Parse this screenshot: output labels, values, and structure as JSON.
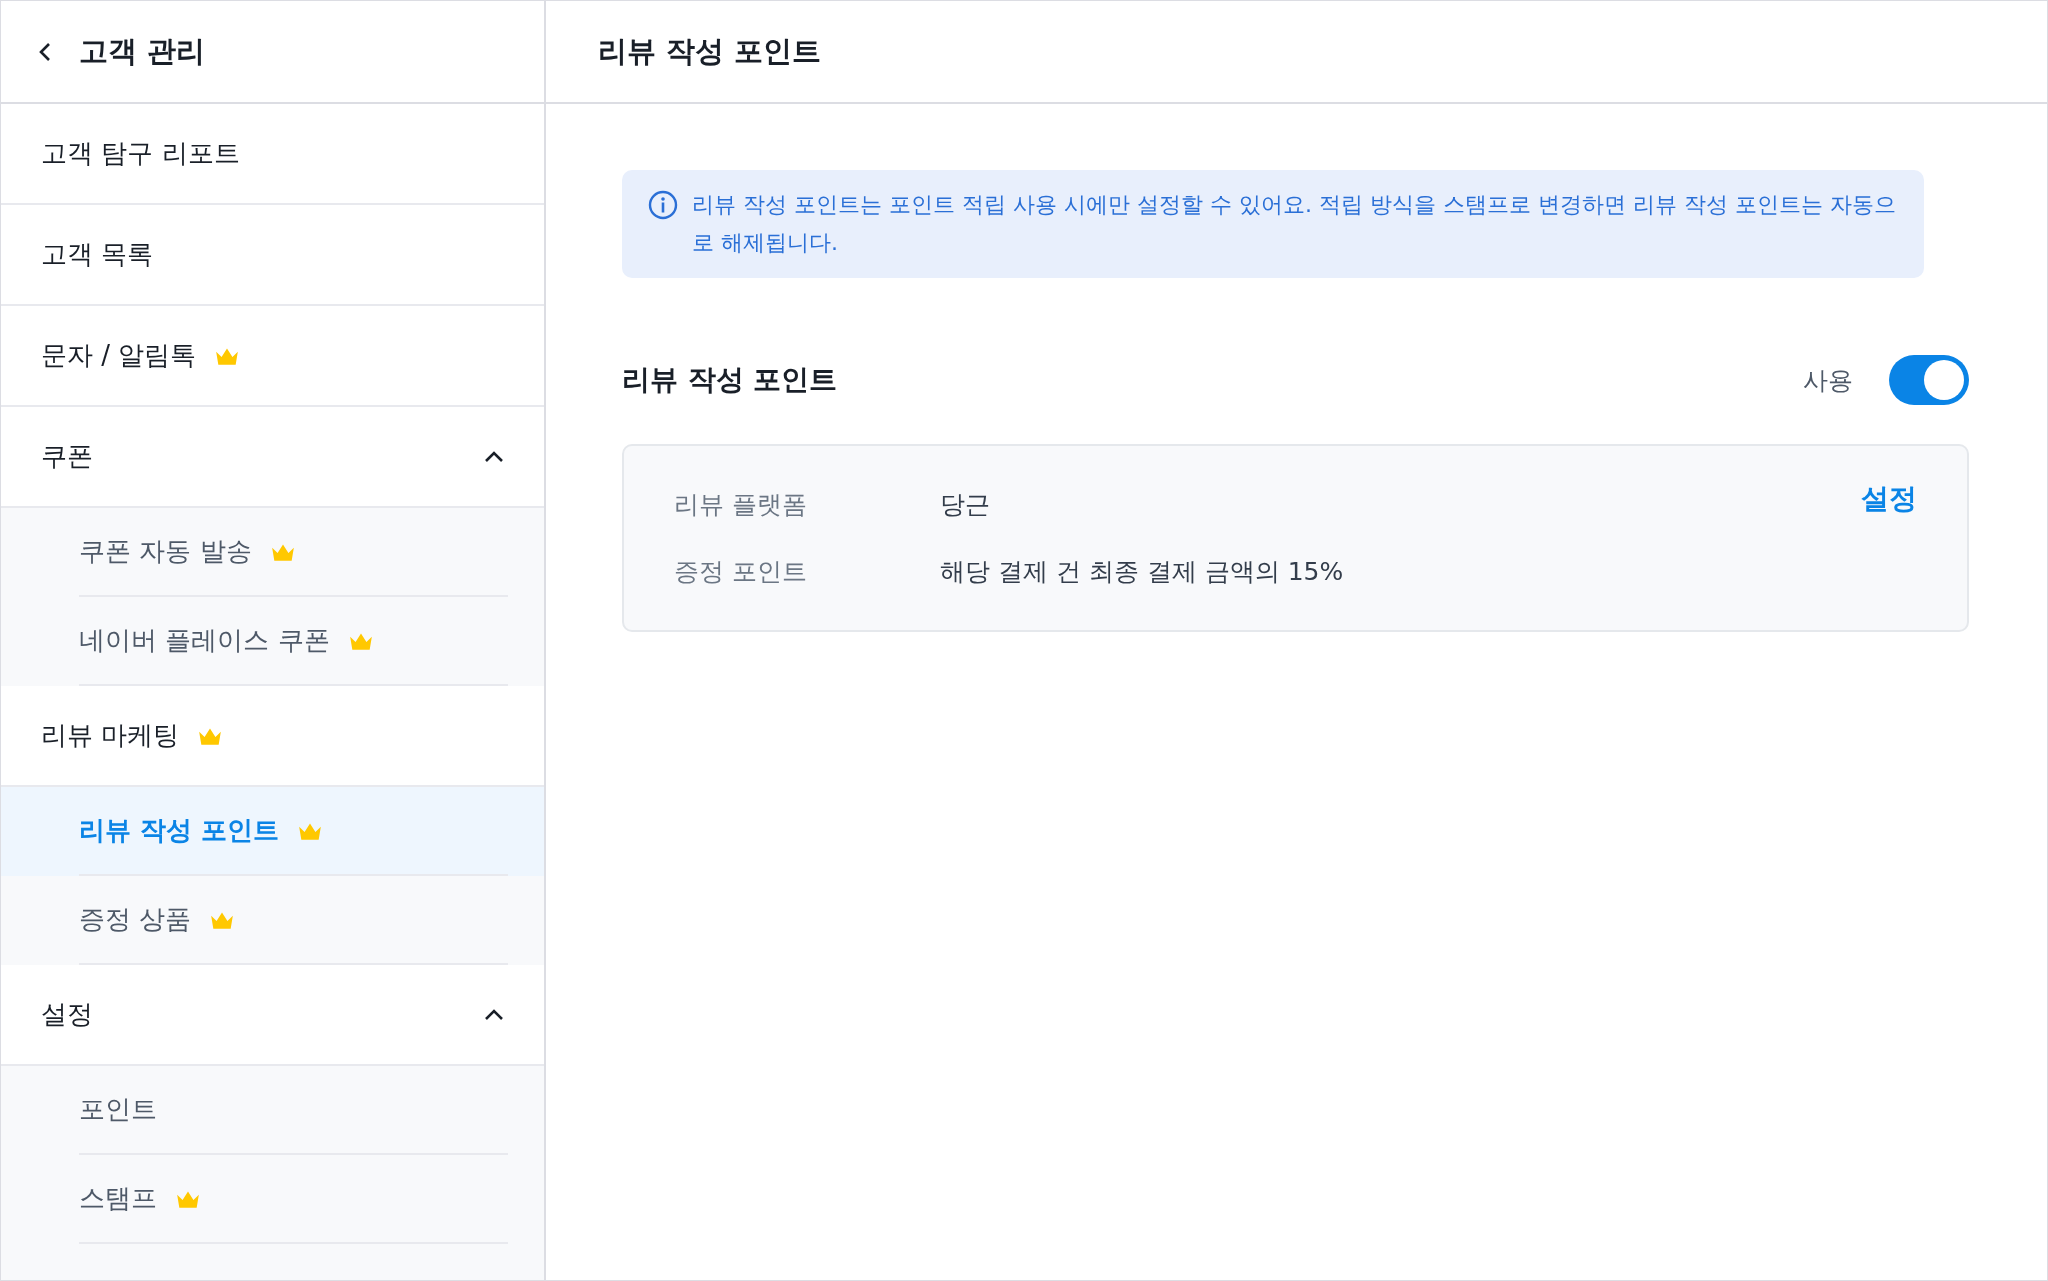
{
  "sidebar": {
    "title": "고객 관리",
    "items": [
      {
        "kind": "item",
        "label": "고객 탐구 리포트",
        "premium": false,
        "selected": false
      },
      {
        "kind": "item",
        "label": "고객 목록",
        "premium": false,
        "selected": false
      },
      {
        "kind": "item",
        "label": "문자 / 알림톡",
        "premium": true,
        "selected": false
      },
      {
        "kind": "group",
        "label": "쿠폰",
        "premium": false,
        "selected": false,
        "expanded": true,
        "children": [
          {
            "label": "쿠폰 자동 발송",
            "premium": true,
            "selected": false
          },
          {
            "label": "네이버 플레이스 쿠폰",
            "premium": true,
            "selected": false
          }
        ]
      },
      {
        "kind": "item",
        "label": "리뷰 마케팅",
        "premium": true,
        "selected": false,
        "children": [
          {
            "label": "리뷰 작성 포인트",
            "premium": true,
            "selected": true
          },
          {
            "label": "증정 상품",
            "premium": true,
            "selected": false
          }
        ]
      },
      {
        "kind": "group",
        "label": "설정",
        "premium": false,
        "selected": false,
        "expanded": true,
        "children": [
          {
            "label": "포인트",
            "premium": false,
            "selected": false
          },
          {
            "label": "스탬프",
            "premium": true,
            "selected": false
          }
        ]
      }
    ]
  },
  "main": {
    "title": "리뷰 작성 포인트",
    "notice": "리뷰 작성 포인트는 포인트 적립 사용 시에만 설정할 수 있어요. 적립 방식을 스탬프로 변경하면 리뷰 작성 포인트는 자동으로 해제됩니다.",
    "section": {
      "title": "리뷰 작성 포인트",
      "toggle": {
        "label": "사용",
        "on": true
      },
      "details": [
        {
          "label": "리뷰 플랫폼",
          "value": "당근"
        },
        {
          "label": "증정 포인트",
          "value": "해당 결제 건 최종 결제 금액의 15%"
        }
      ],
      "settings_link": "설정"
    }
  }
}
